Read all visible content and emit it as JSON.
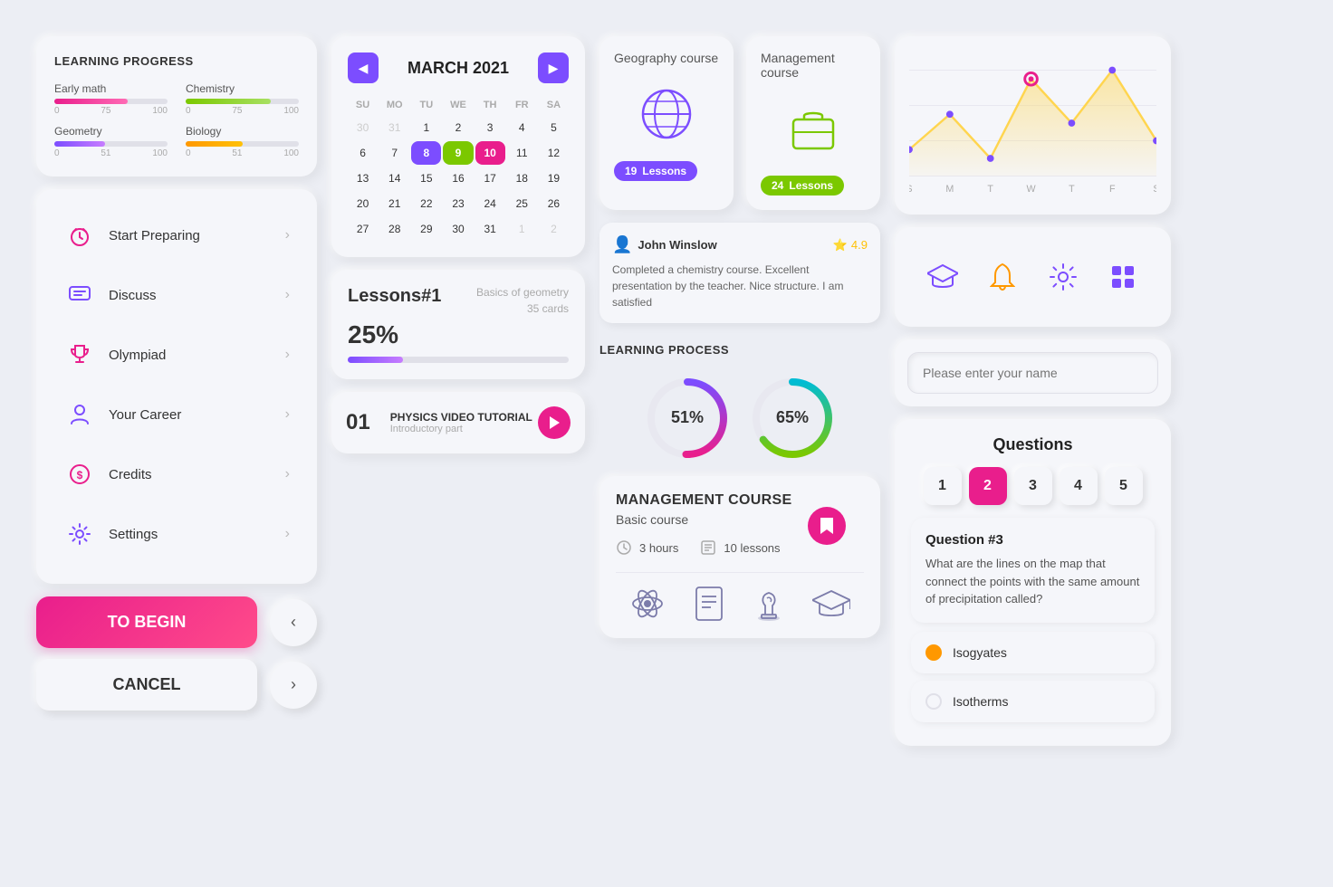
{
  "app": {
    "bg": "#eceef4"
  },
  "learningProgress": {
    "title": "LEARNING PROGRESS",
    "items": [
      {
        "label": "Early math",
        "value": 65,
        "max": 100,
        "marks": [
          "0",
          "75",
          "100"
        ],
        "color": "pink"
      },
      {
        "label": "Chemistry",
        "value": 75,
        "max": 100,
        "marks": [
          "0",
          "75",
          "100"
        ],
        "color": "green"
      },
      {
        "label": "Geometry",
        "value": 45,
        "max": 100,
        "marks": [
          "0",
          "51",
          "100"
        ],
        "color": "purple"
      },
      {
        "label": "Biology",
        "value": 50,
        "max": 100,
        "marks": [
          "0",
          "51",
          "100"
        ],
        "color": "orange"
      }
    ]
  },
  "navMenu": {
    "items": [
      {
        "id": "start-preparing",
        "label": "Start Preparing",
        "icon": "alarm"
      },
      {
        "id": "discuss",
        "label": "Discuss",
        "icon": "chat"
      },
      {
        "id": "olympiad",
        "label": "Olympiad",
        "icon": "trophy"
      },
      {
        "id": "your-career",
        "label": "Your Career",
        "icon": "person"
      },
      {
        "id": "credits",
        "label": "Credits",
        "icon": "dollar"
      },
      {
        "id": "settings",
        "label": "Settings",
        "icon": "gear"
      }
    ]
  },
  "actions": {
    "begin": "TO BEGIN",
    "cancel": "CANCEL"
  },
  "calendar": {
    "title": "MARCH 2021",
    "dayHeaders": [
      "SU",
      "MO",
      "TU",
      "WE",
      "TH",
      "FR",
      "SA"
    ],
    "days": [
      {
        "d": "30",
        "cls": "other-month"
      },
      {
        "d": "31",
        "cls": "other-month"
      },
      {
        "d": "1"
      },
      {
        "d": "2"
      },
      {
        "d": "3"
      },
      {
        "d": "4"
      },
      {
        "d": "5"
      },
      {
        "d": "6"
      },
      {
        "d": "7"
      },
      {
        "d": "8",
        "cls": "today"
      },
      {
        "d": "9",
        "cls": "highlight-green"
      },
      {
        "d": "10",
        "cls": "highlight-pink"
      },
      {
        "d": "11"
      },
      {
        "d": "12"
      },
      {
        "d": "13"
      },
      {
        "d": "14"
      },
      {
        "d": "15"
      },
      {
        "d": "16"
      },
      {
        "d": "17"
      },
      {
        "d": "18"
      },
      {
        "d": "19"
      },
      {
        "d": "20"
      },
      {
        "d": "21"
      },
      {
        "d": "22"
      },
      {
        "d": "23"
      },
      {
        "d": "24"
      },
      {
        "d": "25"
      },
      {
        "d": "26"
      },
      {
        "d": "27"
      },
      {
        "d": "28"
      },
      {
        "d": "29"
      },
      {
        "d": "30"
      },
      {
        "d": "31"
      },
      {
        "d": "1",
        "cls": "other-month"
      },
      {
        "d": "2",
        "cls": "other-month"
      }
    ]
  },
  "lessonsCard": {
    "number": "Lessons#1",
    "subtitle": "Basics of geometry",
    "percent": "25%",
    "cards": "35 cards",
    "barWidth": 25
  },
  "videoCard": {
    "num": "01",
    "title": "PHYSICS VIDEO TUTORIAL",
    "subtitle": "Introductory part"
  },
  "geographyCourse": {
    "title": "Geography course",
    "lessons": "19",
    "lessonsLabel": "Lessons"
  },
  "managementCourseSmall": {
    "title": "Management course",
    "lessons": "24",
    "lessonsLabel": "Lessons"
  },
  "review": {
    "reviewer": "John Winslow",
    "rating": "4.9",
    "text": "Completed a chemistry course. Excellent presentation by the teacher. Nice structure. I am satisfied"
  },
  "learningProcess": {
    "title": "LEARNING PROCESS",
    "progress1": {
      "value": 51,
      "label": "51%"
    },
    "progress2": {
      "value": 65,
      "label": "65%"
    }
  },
  "managementCourse": {
    "title": "MANAGEMENT COURSE",
    "subtitle": "Basic course",
    "hours": "3 hours",
    "lessons": "10 lessons"
  },
  "chart": {
    "days": [
      "S",
      "M",
      "T",
      "W",
      "T",
      "F",
      "S"
    ],
    "points": [
      60,
      90,
      55,
      100,
      75,
      120,
      50
    ]
  },
  "iconsRow": {
    "icons": [
      "graduation",
      "bell",
      "gear",
      "grid"
    ]
  },
  "nameInput": {
    "placeholder": "Please enter your name"
  },
  "questions": {
    "title": "Questions",
    "numbers": [
      "1",
      "2",
      "3",
      "4",
      "5"
    ],
    "activeIndex": 1,
    "question": {
      "label": "Question #3",
      "text": "What are the lines on the map that connect the points with the same amount of precipitation called?"
    },
    "answers": [
      {
        "label": "Isogyates",
        "active": true
      },
      {
        "label": "Isotherms",
        "active": false
      }
    ]
  }
}
